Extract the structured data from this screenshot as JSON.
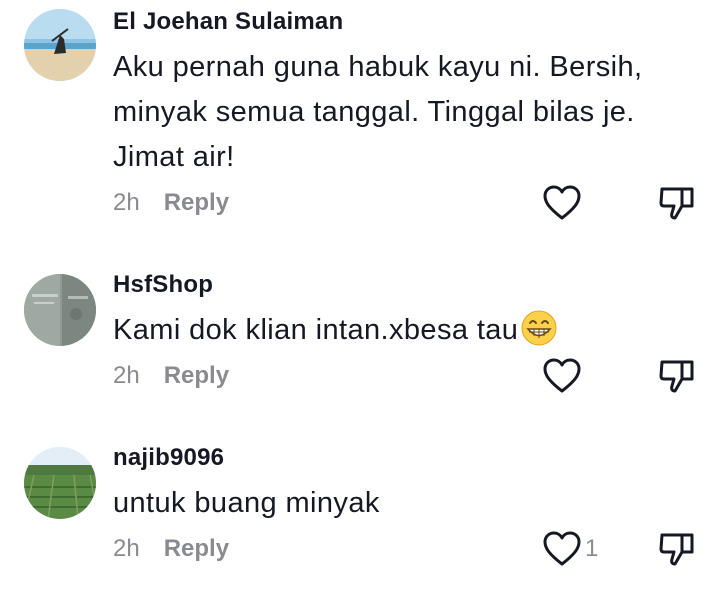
{
  "comments": [
    {
      "username": "El Joehan Sulaiman",
      "text_lines": [
        "Aku pernah guna habuk kayu ni. Bersih,",
        "minyak semua tanggal. Tinggal bilas je.",
        "Jimat air!"
      ],
      "time": "2h",
      "reply_label": "Reply",
      "like_count": ""
    },
    {
      "username": "HsfShop",
      "text": "Kami dok klian intan.xbesa tau",
      "time": "2h",
      "reply_label": "Reply",
      "like_count": ""
    },
    {
      "username": "najib9096",
      "text": "untuk buang minyak",
      "time": "2h",
      "reply_label": "Reply",
      "like_count": "1"
    }
  ],
  "icons": {
    "like": "heart-outline-icon",
    "dislike": "thumbs-down-outline-icon",
    "emoji": "grinning-face-emoji"
  },
  "colors": {
    "text": "#161823",
    "meta": "#8a8b91",
    "icon": "#161823"
  }
}
